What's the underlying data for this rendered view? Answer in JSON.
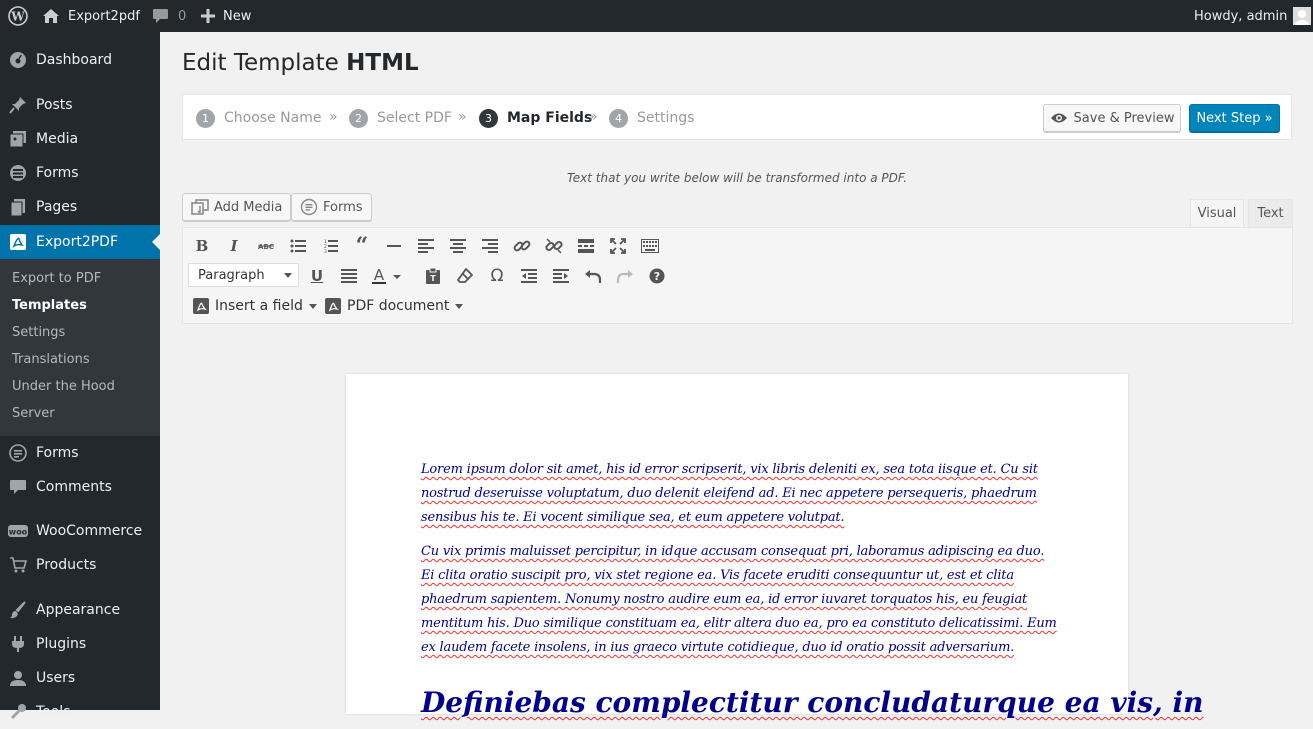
{
  "adminbar": {
    "site_name": "Export2pdf",
    "comments_count": "0",
    "new_label": "New",
    "howdy": "Howdy, admin"
  },
  "sidebar": {
    "items": [
      {
        "label": "Dashboard",
        "icon": "dashboard-icon"
      },
      {
        "label": "Posts",
        "icon": "pin-icon"
      },
      {
        "label": "Media",
        "icon": "media-icon"
      },
      {
        "label": "Forms",
        "icon": "database-icon"
      },
      {
        "label": "Pages",
        "icon": "pages-icon"
      },
      {
        "label": "Export2PDF",
        "icon": "pdf-icon"
      },
      {
        "label": "Forms",
        "icon": "forms-icon"
      },
      {
        "label": "Comments",
        "icon": "comment-icon"
      },
      {
        "label": "WooCommerce",
        "icon": "woo-icon"
      },
      {
        "label": "Products",
        "icon": "cart-icon"
      },
      {
        "label": "Appearance",
        "icon": "brush-icon"
      },
      {
        "label": "Plugins",
        "icon": "plug-icon"
      },
      {
        "label": "Users",
        "icon": "user-icon"
      },
      {
        "label": "Tools",
        "icon": "tools-icon"
      }
    ],
    "submenu": [
      "Export to PDF",
      "Templates",
      "Settings",
      "Translations",
      "Under the Hood",
      "Server"
    ],
    "accent": "#0073aa"
  },
  "page": {
    "title_prefix": "Edit Template",
    "title_strong": "HTML"
  },
  "steps": [
    {
      "num": "1",
      "label": "Choose Name"
    },
    {
      "num": "2",
      "label": "Select PDF"
    },
    {
      "num": "3",
      "label": "Map Fields"
    },
    {
      "num": "4",
      "label": "Settings"
    }
  ],
  "step_separator": "»",
  "buttons": {
    "save_preview": "Save & Preview",
    "next_step": "Next Step »"
  },
  "hint": "Text that you write below will be transformed into a PDF.",
  "editor": {
    "add_media": "Add Media",
    "forms": "Forms",
    "tab_visual": "Visual",
    "tab_text": "Text",
    "format_select": "Paragraph",
    "insert_field": "Insert a field",
    "pdf_document": "PDF document"
  },
  "content": {
    "p1": "Lorem ipsum dolor sit amet, his id error scripserit, vix libris deleniti ex, sea tota iisque et. Cu sit nostrud deseruisse voluptatum, duo delenit eleifend ad. Ei nec appetere persequeris, phaedrum sensibus his te. Ei vocent similique sea, et eum appetere volutpat.",
    "p2": "Cu vix primis maluisset percipitur, in idque accusam consequat pri, laboramus adipiscing ea duo. Ei clita oratio suscipit pro, vix stet regione ea. Vis facete eruditi consequuntur ut, est et clita phaedrum sapientem. Nonumy nostro audire eum ea, id error iuvaret torquatos his, eu feugiat mentitum his. Duo similique constituam ea, elitr altera duo ea, pro ea constituto delicatissimi. Eum ex laudem facete insolens, in ius graeco virtute cotidieque, duo id oratio possit adversarium.",
    "heading": "Definiebas complectitur concludaturque ea vis, in"
  }
}
